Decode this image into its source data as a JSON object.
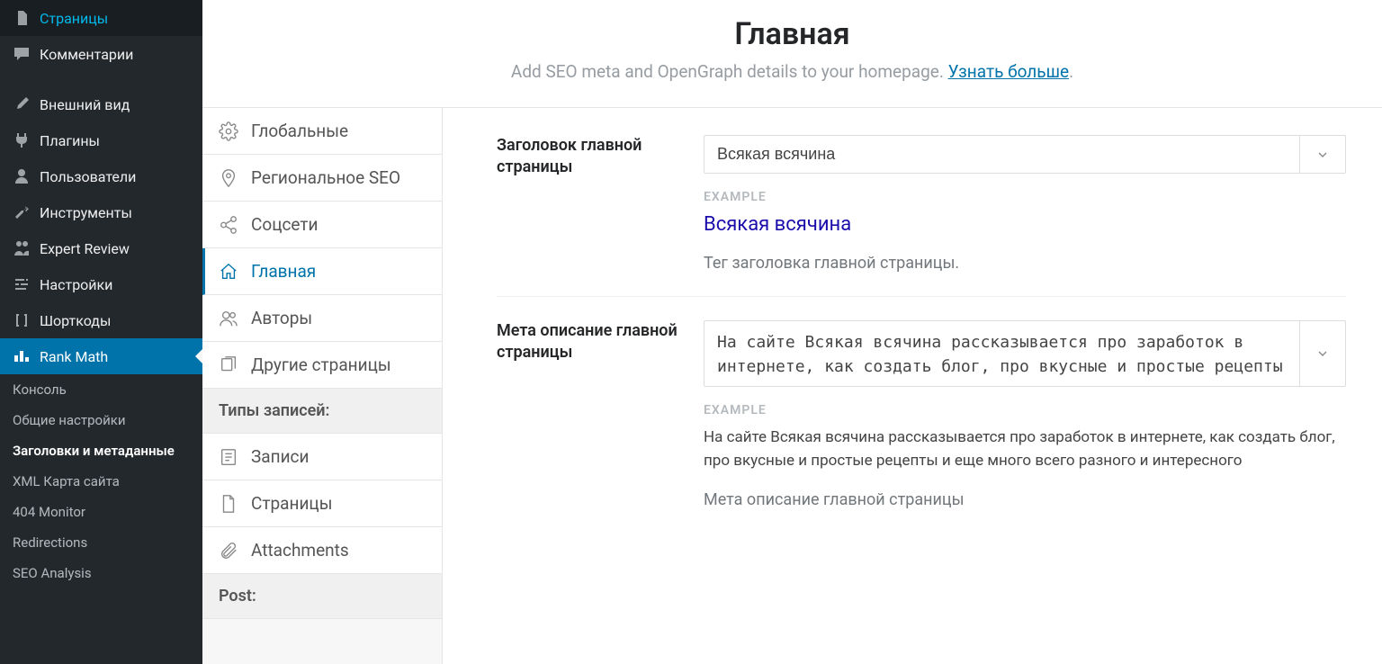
{
  "sidebar": {
    "ps": "Страницы",
    "cm": "Комментарии",
    "ap": "Внешний вид",
    "pl": "Плагины",
    "us": "Пользователи",
    "tl": "Инструменты",
    "er": "Expert Review",
    "st": "Настройки",
    "sc": "Шорткоды",
    "rm": "Rank Math",
    "s1": "Консоль",
    "s2": "Общие настройки",
    "s3": "Заголовки и метаданные",
    "s4": "XML Карта сайта",
    "s5": "404 Monitor",
    "s6": "Redirections",
    "s7": "SEO Analysis"
  },
  "header": {
    "title": "Главная",
    "sub": "Add SEO meta and OpenGraph details to your homepage. ",
    "link": "Узнать больше"
  },
  "tabs": {
    "t1": "Глобальные",
    "t2": "Региональное SEO",
    "t3": "Соцсети",
    "t4": "Главная",
    "t5": "Авторы",
    "t6": "Другие страницы",
    "sh": "Типы записей:",
    "t7": "Записи",
    "t8": "Страницы",
    "t9": "Attachments",
    "sh2": "Post:"
  },
  "f1": {
    "label": "Заголовок главной страницы",
    "value": "Всякая всячина",
    "exlabel": "EXAMPLE",
    "exval": "Всякая всячина",
    "help": "Тег заголовка главной страницы."
  },
  "f2": {
    "label": "Мета описание главной страницы",
    "value": "На сайте Всякая всячина рассказывается про заработок в интернете, как создать блог, про вкусные и простые рецепты и еще много всего разного и интересного",
    "exlabel": "EXAMPLE",
    "exval": "На сайте Всякая всячина рассказывается про заработок в интернете, как создать блог, про вкусные и простые рецепты и еще много всего разного и интересного",
    "help": "Мета описание главной страницы"
  }
}
